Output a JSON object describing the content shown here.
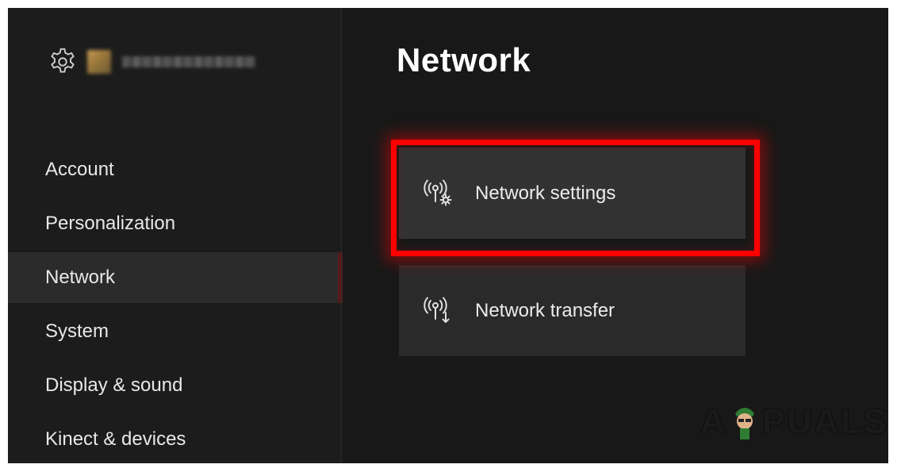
{
  "profile": {
    "gamertag": "Alexandr Ioan"
  },
  "sidebar": {
    "items": [
      {
        "label": "Account"
      },
      {
        "label": "Personalization"
      },
      {
        "label": "Network"
      },
      {
        "label": "System"
      },
      {
        "label": "Display & sound"
      },
      {
        "label": "Kinect & devices"
      }
    ],
    "active": "Network"
  },
  "main": {
    "title": "Network",
    "tiles": [
      {
        "label": "Network settings",
        "icon": "network-settings-icon"
      },
      {
        "label": "Network transfer",
        "icon": "network-transfer-icon"
      }
    ]
  },
  "watermark": {
    "text_left": "A",
    "text_right": "PUALS"
  },
  "colors": {
    "highlight": "#ff0000",
    "background": "#181818",
    "sidebar": "#1c1c1c"
  }
}
